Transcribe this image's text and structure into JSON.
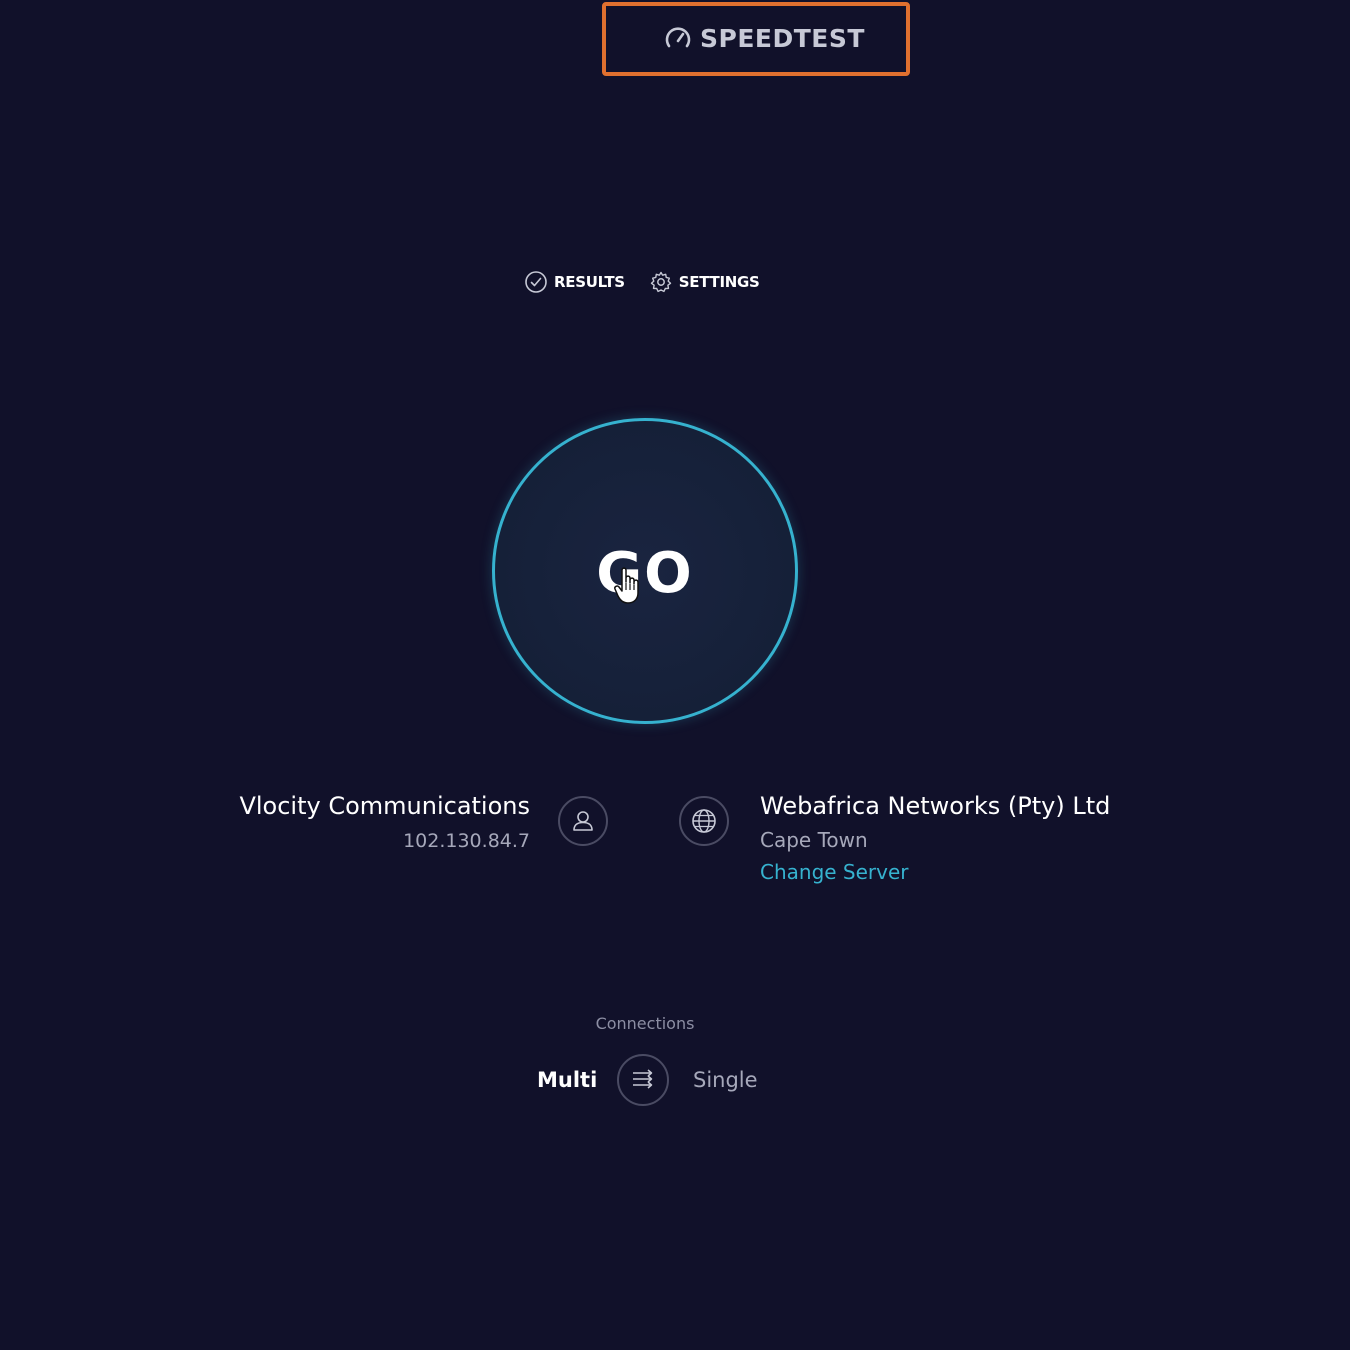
{
  "header": {
    "logo_text": "SPEEDTEST",
    "highlight_color": "#e0702f"
  },
  "nav": {
    "results_label": "RESULTS",
    "settings_label": "SETTINGS"
  },
  "go_button": {
    "label": "GO",
    "ring_color": "#36b2cf"
  },
  "isp": {
    "name": "Vlocity Communications",
    "ip": "102.130.84.7"
  },
  "server": {
    "name": "Webafrica Networks (Pty) Ltd",
    "city": "Cape Town",
    "change_label": "Change Server",
    "link_color": "#36b2cf"
  },
  "connections": {
    "label": "Connections",
    "multi_label": "Multi",
    "single_label": "Single",
    "selected": "Multi"
  },
  "icons": [
    "speedometer-icon",
    "check-circle-icon",
    "gear-icon",
    "hand-cursor-icon",
    "user-icon",
    "globe-icon",
    "connections-arrows-icon"
  ],
  "colors": {
    "background": "#11112a",
    "accent": "#36b2cf"
  }
}
